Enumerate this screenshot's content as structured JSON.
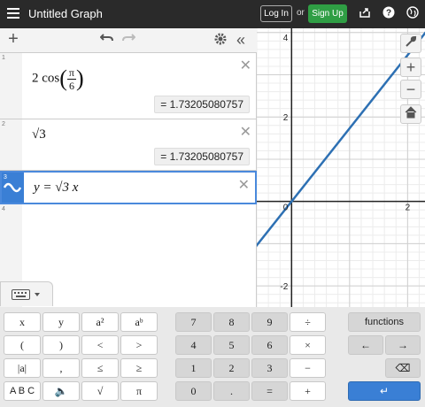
{
  "app": {
    "title": "Untitled Graph",
    "login_label": "Log In",
    "or_label": "or",
    "signup_label": "Sign Up"
  },
  "expressions": [
    {
      "index": "1",
      "latex": "2 cos(π/6)",
      "result": "= 1.73205080757"
    },
    {
      "index": "2",
      "latex": "√3",
      "result": "= 1.73205080757"
    },
    {
      "index": "3",
      "latex": "y = √3 x"
    },
    {
      "index": "4"
    }
  ],
  "graph": {
    "type": "line",
    "x_ticks": [
      "0",
      "2"
    ],
    "y_ticks": [
      "4",
      "2",
      "-2"
    ],
    "line": {
      "equation": "y = √3 x",
      "slope": 1.7320508,
      "color": "#2d70b3"
    },
    "xlim": [
      -0.6,
      2.3
    ],
    "ylim": [
      -2.5,
      4.1
    ]
  },
  "keypad": {
    "letters": [
      "x",
      "y",
      "a²",
      "aᵇ",
      "(",
      ")",
      "<",
      ">",
      "|a|",
      ",",
      "≤",
      "≥",
      "A B C",
      "🔈",
      "√",
      "π"
    ],
    "numbers": [
      "7",
      "8",
      "9",
      "÷",
      "4",
      "5",
      "6",
      "×",
      "1",
      "2",
      "3",
      "−",
      "0",
      ".",
      "=",
      "+"
    ],
    "functions_label": "functions",
    "left_arrow": "←",
    "right_arrow": "→",
    "backspace": "⌫",
    "enter": "↵"
  },
  "colors": {
    "accent": "#3a7fd5",
    "signup": "#2f9e44",
    "graph_line": "#2d70b3"
  }
}
